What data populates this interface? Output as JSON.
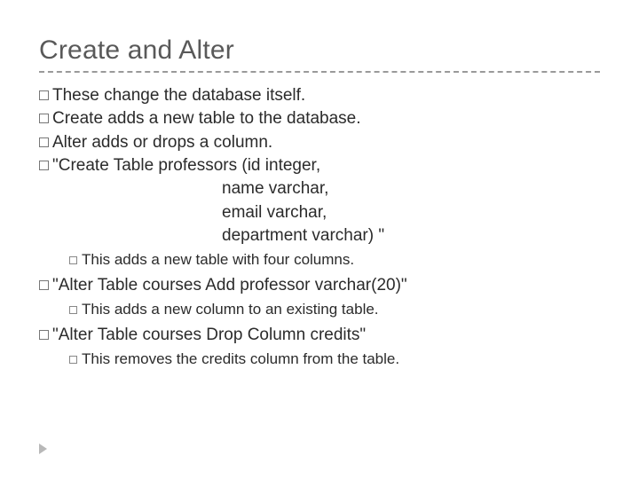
{
  "title": "Create and Alter",
  "bullets": {
    "b1": "These change the database itself.",
    "b2": "Create adds a new table to the database.",
    "b3": "Alter adds or drops a column.",
    "b4_l1": "\"Create Table professors (id integer,",
    "b4_l2": "name varchar,",
    "b4_l3": "email varchar,",
    "b4_l4": "department varchar) \"",
    "b4_sub": "This adds a new table with four columns.",
    "b5": "\"Alter Table courses Add professor varchar(20)\"",
    "b5_sub": "This adds a new column to an existing table.",
    "b6": "\"Alter Table courses Drop Column credits\"",
    "b6_sub": "This removes the credits column from the table."
  }
}
